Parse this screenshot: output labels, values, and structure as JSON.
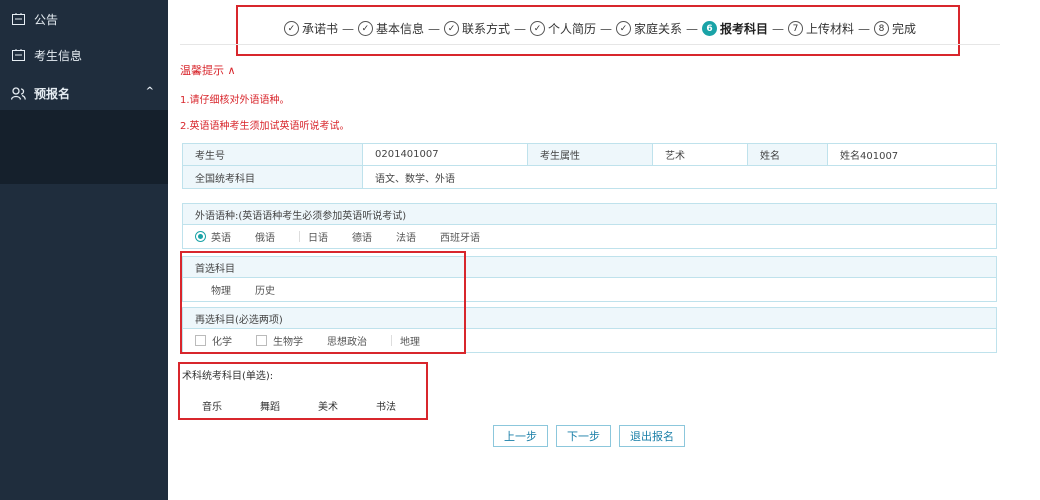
{
  "sidebar": {
    "items": [
      {
        "label": "公告",
        "icon": "board-icon"
      },
      {
        "label": "考生信息",
        "icon": "board-icon"
      },
      {
        "label": "预报名",
        "icon": "people-icon",
        "caret": "^"
      }
    ]
  },
  "steps": [
    {
      "num": "✓",
      "label": "承诺书"
    },
    {
      "num": "✓",
      "label": "基本信息"
    },
    {
      "num": "✓",
      "label": "联系方式"
    },
    {
      "num": "✓",
      "label": "个人简历"
    },
    {
      "num": "✓",
      "label": "家庭关系"
    },
    {
      "num": "6",
      "label": "报考科目"
    },
    {
      "num": "7",
      "label": "上传材料"
    },
    {
      "num": "8",
      "label": "完成"
    }
  ],
  "step_separator": "—",
  "tips": {
    "title": "温馨提示 ∧",
    "items": [
      "1.请仔细核对外语语种。",
      "2.英语语种考生须加试英语听说考试。"
    ]
  },
  "info": {
    "exam_no_label": "考生号",
    "exam_no": "0201401007",
    "attr_label": "考生属性",
    "attr": "艺术",
    "name_label": "姓名",
    "name": "姓名401007",
    "national_label": "全国统考科目",
    "national": "语文、数学、外语"
  },
  "foreign": {
    "title": "外语语种:(英语语种考生必须参加英语听说考试)",
    "options": [
      "英语",
      "俄语",
      "日语",
      "德语",
      "法语",
      "西班牙语"
    ],
    "selected": "英语"
  },
  "first_choice": {
    "title": "首选科目",
    "options": [
      "物理",
      "历史"
    ]
  },
  "second_choice": {
    "title": "再选科目(必选两项)",
    "options": [
      "化学",
      "生物学",
      "思想政治",
      "地理"
    ]
  },
  "art": {
    "title": "术科统考科目(单选):",
    "options": [
      "音乐",
      "舞蹈",
      "美术",
      "书法"
    ]
  },
  "buttons": {
    "prev": "上一步",
    "next": "下一步",
    "exit": "退出报名"
  },
  "colors": {
    "accent": "#1aa3a7",
    "highlight": "#d8262c",
    "sidebar": "#1f2d3d"
  }
}
